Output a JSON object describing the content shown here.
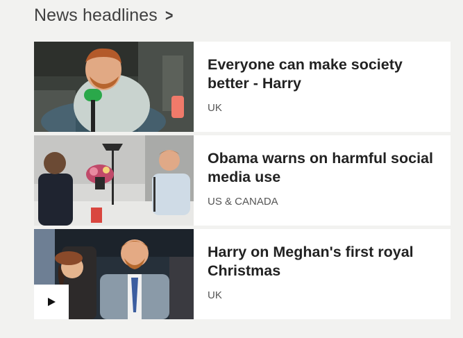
{
  "section": {
    "title": "News headlines",
    "chevron": ">"
  },
  "headlines": [
    {
      "title": "Everyone can make society better - Harry",
      "category": "UK",
      "image_icon": "photo-icon"
    },
    {
      "title": "Obama warns on harmful social media use",
      "category": "US & CANADA",
      "image_icon": "photo-icon"
    },
    {
      "title": "Harry on Meghan's first royal Christmas",
      "category": "UK",
      "image_icon": "photo-icon",
      "media_icon": "play-icon"
    }
  ],
  "colors": {
    "page_background": "#f2f2f0",
    "card_background": "#ffffff",
    "headline_text": "#222222",
    "category_text": "#555555",
    "section_title": "#404040"
  }
}
